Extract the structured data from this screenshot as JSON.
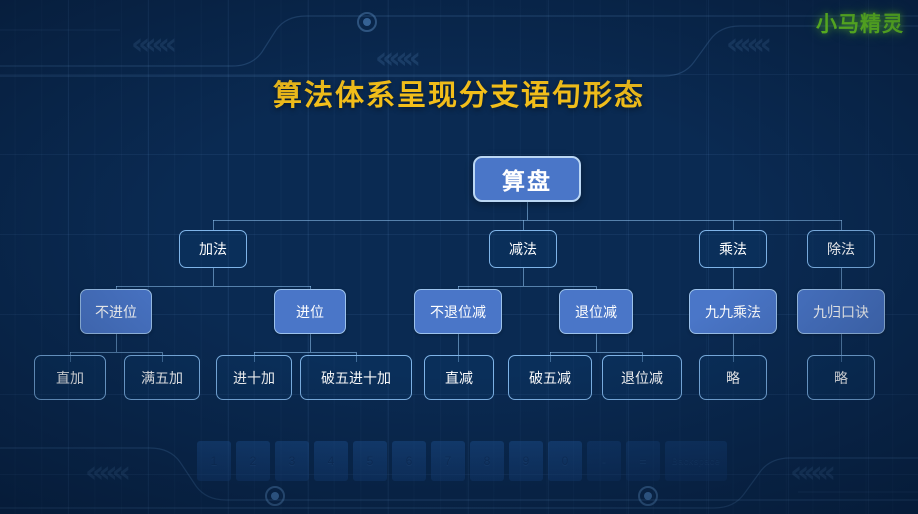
{
  "slide": {
    "title": "算法体系呈现分支语句形态",
    "logo": "小马精灵",
    "title_color": "#F2BE1A",
    "logo_color": "#7BEF1E",
    "background_color": "#0a2a52",
    "node_fill_color": "#4A76C8",
    "node_border_color": "#7FB4E8",
    "connector_color": "#96C8F5"
  },
  "tree": {
    "root": {
      "label": "算盘"
    },
    "level2": [
      {
        "label": "加法"
      },
      {
        "label": "减法"
      },
      {
        "label": "乘法"
      },
      {
        "label": "除法"
      }
    ],
    "level3": [
      {
        "label": "不进位"
      },
      {
        "label": "进位"
      },
      {
        "label": "不退位减"
      },
      {
        "label": "退位减"
      },
      {
        "label": "九九乘法"
      },
      {
        "label": "九归口诀"
      }
    ],
    "level4": [
      {
        "label": "直加"
      },
      {
        "label": "满五加"
      },
      {
        "label": "进十加"
      },
      {
        "label": "破五进十加"
      },
      {
        "label": "直减"
      },
      {
        "label": "破五减"
      },
      {
        "label": "退位减"
      },
      {
        "label": "略"
      },
      {
        "label": "略"
      }
    ]
  },
  "decor": {
    "chevrons": [
      "«««",
      "«««",
      "«««",
      "«««",
      "«««"
    ],
    "keyboard_keys": [
      "1",
      "2",
      "3",
      "4",
      "5",
      "6",
      "7",
      "8",
      "9",
      "0",
      "-",
      "=",
      "Backspace"
    ]
  }
}
